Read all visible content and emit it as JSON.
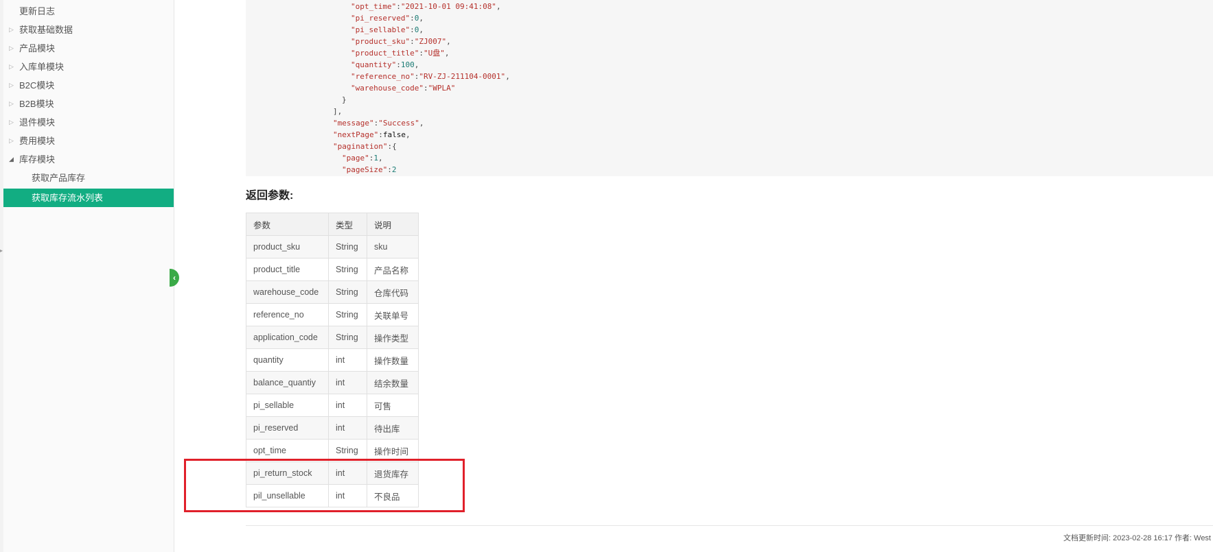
{
  "sidebar": {
    "items": [
      {
        "label": "更新日志",
        "caret": ""
      },
      {
        "label": "获取基础数据",
        "caret": "▷"
      },
      {
        "label": "产品模块",
        "caret": "▷"
      },
      {
        "label": "入库单模块",
        "caret": "▷"
      },
      {
        "label": "B2C模块",
        "caret": "▷"
      },
      {
        "label": "B2B模块",
        "caret": "▷"
      },
      {
        "label": "退件模块",
        "caret": "▷"
      },
      {
        "label": "费用模块",
        "caret": "▷"
      },
      {
        "label": "库存模块",
        "caret": "◢"
      }
    ],
    "sub_items": [
      {
        "label": "获取产品库存"
      },
      {
        "label": "获取库存流水列表"
      }
    ],
    "active_color": "#12ad82"
  },
  "code": {
    "lines": [
      {
        "key": "\"opt_time\"",
        "val": "\"2021-10-01 09:41:08\"",
        "tail": ","
      },
      {
        "key": "\"pi_reserved\"",
        "val": "0",
        "tail": ","
      },
      {
        "key": "\"pi_sellable\"",
        "val": "0",
        "tail": ","
      },
      {
        "key": "\"product_sku\"",
        "val": "\"ZJ007\"",
        "tail": ","
      },
      {
        "key": "\"product_title\"",
        "val": "\"U盘\"",
        "tail": ","
      },
      {
        "key": "\"quantity\"",
        "val": "100",
        "tail": ","
      },
      {
        "key": "\"reference_no\"",
        "val": "\"RV-ZJ-211104-0001\"",
        "tail": ","
      },
      {
        "key": "\"warehouse_code\"",
        "val": "\"WPLA\"",
        "tail": ""
      }
    ],
    "close_brace": "}",
    "close_bracket": "],",
    "message_key": "\"message\"",
    "message_val": "\"Success\"",
    "nextpage_key": "\"nextPage\"",
    "nextpage_val": "false",
    "pagination_key": "\"pagination\"",
    "pagination_open": ":{",
    "page_key": "\"page\"",
    "page_val": "1",
    "pagesize_key": "\"pageSize\"",
    "pagesize_val": "2",
    "colon": ":",
    "comma": ","
  },
  "return_heading": "返回参数:",
  "table": {
    "headers": [
      "参数",
      "类型",
      "说明"
    ],
    "rows": [
      [
        "product_sku",
        "String",
        "sku"
      ],
      [
        "product_title",
        "String",
        "产品名称"
      ],
      [
        "warehouse_code",
        "String",
        "仓库代码"
      ],
      [
        "reference_no",
        "String",
        "关联单号"
      ],
      [
        "application_code",
        "String",
        "操作类型"
      ],
      [
        "quantity",
        "int",
        "操作数量"
      ],
      [
        "balance_quantiy",
        "int",
        "结余数量"
      ],
      [
        "pi_sellable",
        "int",
        "可售"
      ],
      [
        "pi_reserved",
        "int",
        "待出库"
      ],
      [
        "opt_time",
        "String",
        "操作时间"
      ],
      [
        "pi_return_stock",
        "int",
        "退货库存"
      ],
      [
        "pil_unsellable",
        "int",
        "不良品"
      ]
    ]
  },
  "footer": "文档更新时间: 2023-02-28 16:17 作者: West",
  "colors": {
    "highlight": "#e0202a",
    "collapse_button": "#3aaa47"
  }
}
